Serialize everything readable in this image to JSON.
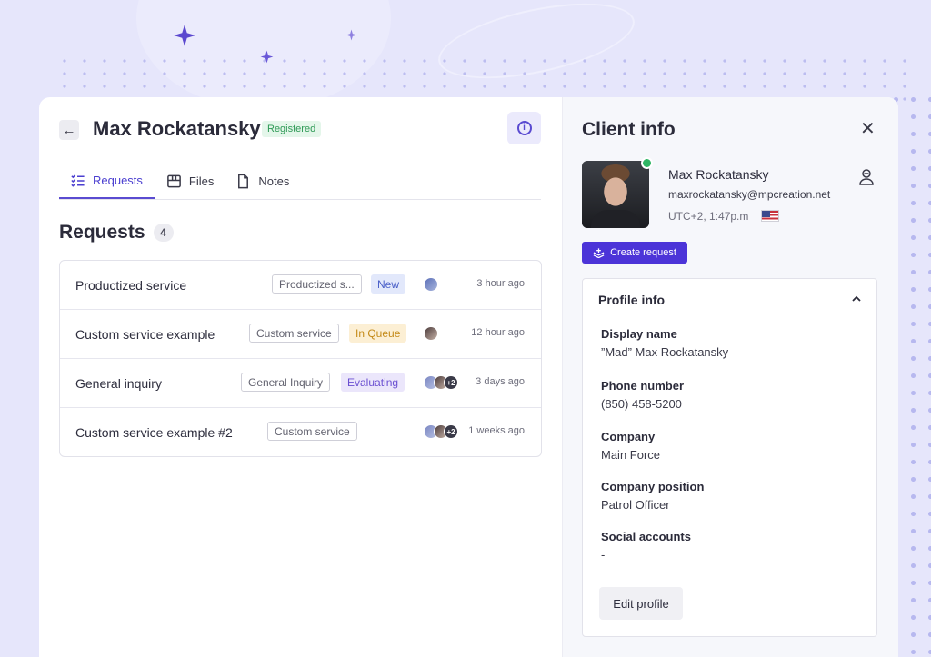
{
  "header": {
    "title": "Max Rockatansky",
    "status_badge": "Registered"
  },
  "tabs": [
    {
      "label": "Requests",
      "icon": "list-check-icon",
      "active": true
    },
    {
      "label": "Files",
      "icon": "box-icon",
      "active": false
    },
    {
      "label": "Notes",
      "icon": "document-icon",
      "active": false
    }
  ],
  "requests": {
    "title": "Requests",
    "count": "4",
    "items": [
      {
        "name": "Productized service",
        "service_tag": "Productized s...",
        "status": "New",
        "time": "3 hour ago"
      },
      {
        "name": "Custom service example",
        "service_tag": "Custom service",
        "status": "In Queue",
        "time": "12 hour ago"
      },
      {
        "name": "General inquiry",
        "service_tag": "General Inquiry",
        "status": "Evaluating",
        "avatars_extra": "+2",
        "time": "3 days ago"
      },
      {
        "name": "Custom service example #2",
        "service_tag": "Custom service",
        "status": "",
        "avatars_extra": "+2",
        "time": "1 weeks ago"
      }
    ]
  },
  "client_info": {
    "title": "Client info",
    "name": "Max Rockatansky",
    "email": "maxrockatansky@mpcreation.net",
    "timezone": "UTC+2, 1:47p.m",
    "create_request_label": "Create request"
  },
  "profile_info": {
    "title": "Profile info",
    "fields": [
      {
        "label": "Display name",
        "value": "”Mad” Max Rockatansky"
      },
      {
        "label": "Phone number",
        "value": "(850) 458-5200"
      },
      {
        "label": "Company",
        "value": "Main Force"
      },
      {
        "label": "Company position",
        "value": "Patrol Officer"
      },
      {
        "label": "Social accounts",
        "value": "-"
      }
    ],
    "edit_label": "Edit profile"
  },
  "colors": {
    "accent": "#4c34d8",
    "registered": "#2f9a56",
    "online": "#2fb564"
  }
}
